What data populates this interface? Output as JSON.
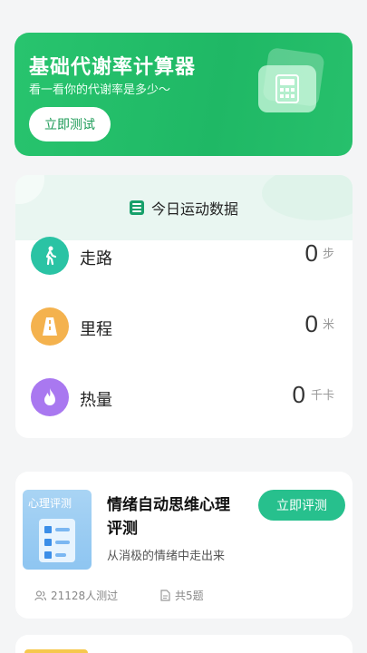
{
  "banner": {
    "title": "基础代谢率计算器",
    "subtitle": "看一看你的代谢率是多少～",
    "button": "立即测试",
    "icon": "calculator-icon"
  },
  "stats": {
    "title": "今日运动数据",
    "title_icon": "list-icon",
    "items": [
      {
        "label": "走路",
        "value": "0",
        "unit": "步",
        "icon": "walk-icon",
        "color": "#2ac3a4"
      },
      {
        "label": "里程",
        "value": "0",
        "unit": "米",
        "icon": "road-icon",
        "color": "#f4b24e"
      },
      {
        "label": "热量",
        "value": "0",
        "unit": "千卡",
        "icon": "flame-icon",
        "color": "#a978f0"
      }
    ]
  },
  "test": {
    "thumb_label": "心理评测",
    "title": "情绪自动思维心理评测",
    "subtitle": "从消极的情绪中走出来",
    "button": "立即评测",
    "participants": "21128人测过",
    "questions": "共5题"
  },
  "colors": {
    "brand_green": "#28c46e",
    "teal": "#27c08d"
  }
}
